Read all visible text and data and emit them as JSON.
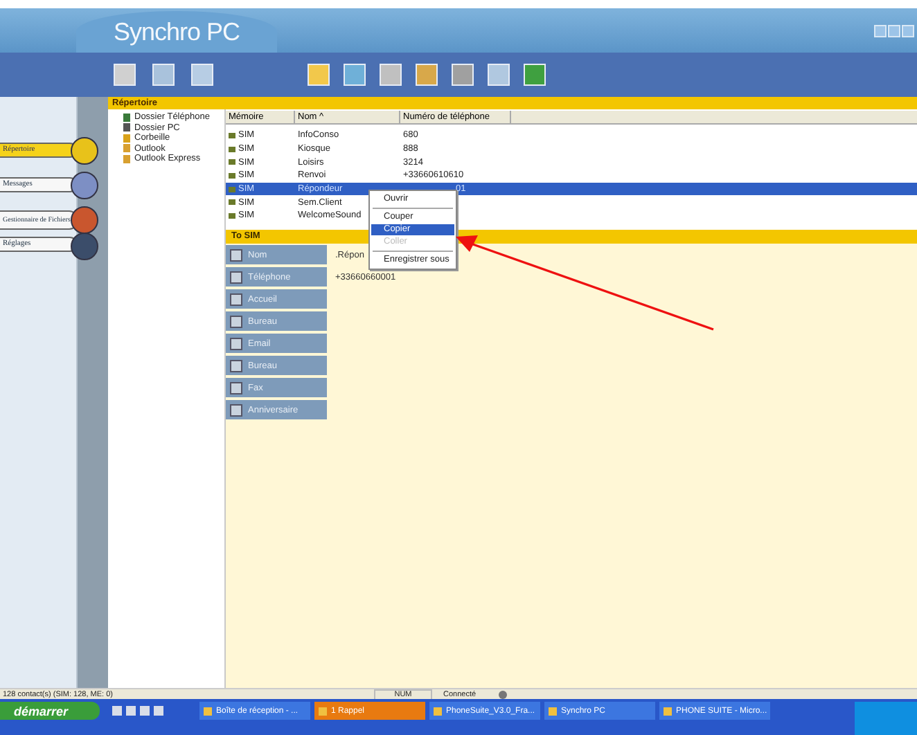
{
  "window": {
    "title": "Synchro PC"
  },
  "nav": [
    {
      "label": "Répertoire",
      "selected": true,
      "color": "#e8c21a"
    },
    {
      "label": "Messages",
      "selected": false,
      "color": "#7d8fc4"
    },
    {
      "label": "Gestionnaire de Fichiers",
      "selected": false,
      "color": "#c9562e"
    },
    {
      "label": "Réglages",
      "selected": false,
      "color": "#3b4d6a"
    }
  ],
  "section_title": "Répertoire",
  "tree": [
    {
      "label": "Dossier Téléphone",
      "kind": "phone"
    },
    {
      "label": "Dossier PC",
      "kind": "pc"
    },
    {
      "label": "Corbeille",
      "kind": "bin"
    },
    {
      "label": "Outlook",
      "kind": "outlook"
    },
    {
      "label": "Outlook Express",
      "kind": "outlook"
    }
  ],
  "table": {
    "columns": [
      "Mémoire",
      "Nom ^",
      "Numéro de téléphone"
    ],
    "rows": [
      {
        "memory": "SIM",
        "name": "InfoConso",
        "number": "680",
        "selected": false
      },
      {
        "memory": "SIM",
        "name": "Kiosque",
        "number": "888",
        "selected": false
      },
      {
        "memory": "SIM",
        "name": "Loisirs",
        "number": "3214",
        "selected": false
      },
      {
        "memory": "SIM",
        "name": "Renvoi",
        "number": "+33660610610",
        "selected": false
      },
      {
        "memory": "SIM",
        "name": "Répondeur",
        "number": "01",
        "selected": true
      },
      {
        "memory": "SIM",
        "name": "Sem.Client",
        "selected": false
      },
      {
        "memory": "SIM",
        "name": "WelcomeSound",
        "selected": false
      }
    ]
  },
  "context_menu": [
    {
      "label": "Ouvrir",
      "selected": false,
      "disabled": false,
      "separator_after": true
    },
    {
      "label": "Couper",
      "selected": false,
      "disabled": false,
      "separator_after": false
    },
    {
      "label": "Copier",
      "selected": true,
      "disabled": false,
      "separator_after": false
    },
    {
      "label": "Coller",
      "selected": false,
      "disabled": true,
      "separator_after": true
    },
    {
      "label": "Enregistrer sous",
      "selected": false,
      "disabled": false,
      "separator_after": false
    }
  ],
  "detail": {
    "title": "To SIM",
    "fields": [
      {
        "label": "Nom",
        "value": ".Répon"
      },
      {
        "label": "Téléphone",
        "value": "+33660660001"
      },
      {
        "label": "Accueil"
      },
      {
        "label": "Bureau"
      },
      {
        "label": "Email"
      },
      {
        "label": "Bureau"
      },
      {
        "label": "Fax"
      },
      {
        "label": "Anniversaire"
      }
    ]
  },
  "status_bar": {
    "contacts": "128 contact(s) (SIM: 128, ME: 0)",
    "num": "NUM",
    "connection": "Connecté"
  },
  "taskbar": {
    "start": "démarrer",
    "tasks": [
      {
        "label": "Boîte de réception - ...",
        "selected": false
      },
      {
        "label": "1 Rappel",
        "selected": true
      },
      {
        "label": "PhoneSuite_V3.0_Fra...",
        "selected": false
      },
      {
        "label": "Synchro PC",
        "selected": false
      },
      {
        "label": "PHONE SUITE - Micro...",
        "selected": false
      }
    ]
  }
}
